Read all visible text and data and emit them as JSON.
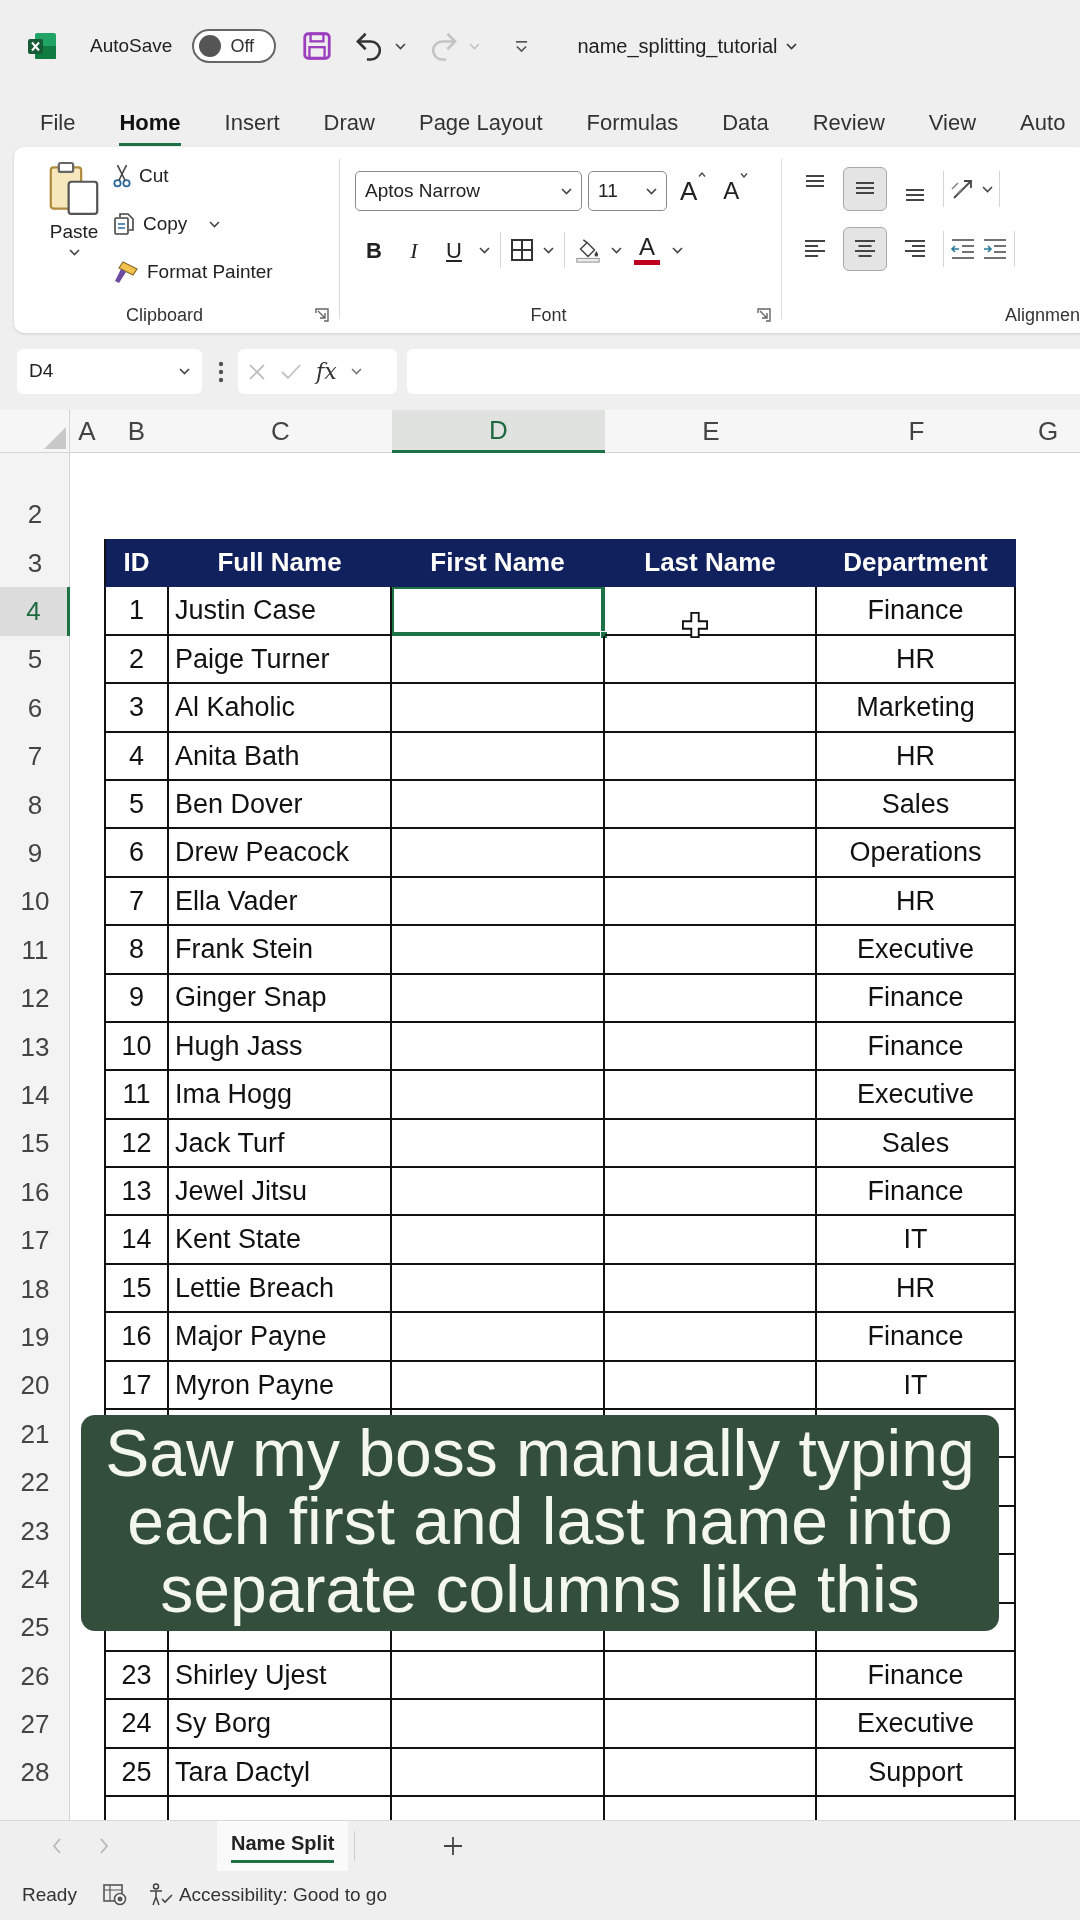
{
  "title_bar": {
    "autosave_label": "AutoSave",
    "autosave_toggle": {
      "label": "Off",
      "on": false
    },
    "undo": {
      "disabled": false
    },
    "redo": {
      "disabled": true
    },
    "file_name": "name_splitting_tutorial"
  },
  "ribbon_tabs": [
    {
      "label": "File",
      "selected": false
    },
    {
      "label": "Home",
      "selected": true
    },
    {
      "label": "Insert",
      "selected": false
    },
    {
      "label": "Draw",
      "selected": false
    },
    {
      "label": "Page Layout",
      "selected": false
    },
    {
      "label": "Formulas",
      "selected": false
    },
    {
      "label": "Data",
      "selected": false
    },
    {
      "label": "Review",
      "selected": false
    },
    {
      "label": "View",
      "selected": false
    },
    {
      "label": "Auto",
      "selected": false
    }
  ],
  "ribbon": {
    "clipboard": {
      "paste": "Paste",
      "cut": "Cut",
      "copy": "Copy",
      "format_painter": "Format Painter",
      "label": "Clipboard"
    },
    "font": {
      "font_name": "Aptos Narrow",
      "font_size": "11",
      "grow": "A",
      "shrink": "A",
      "bold": "B",
      "italic": "I",
      "underline": "U",
      "font_color": "A",
      "label": "Font"
    },
    "alignment": {
      "vertical": [
        {
          "kind": "top",
          "selected": false
        },
        {
          "kind": "middle",
          "selected": true
        },
        {
          "kind": "bottom",
          "selected": false
        }
      ],
      "horizontal": [
        {
          "kind": "left",
          "selected": false
        },
        {
          "kind": "center",
          "selected": true
        },
        {
          "kind": "right",
          "selected": false
        }
      ],
      "label": "Alignmen"
    }
  },
  "formula_bar": {
    "name_box": "D4",
    "function_label": "fx"
  },
  "sheet": {
    "columns": [
      {
        "letter": "A",
        "selected": false
      },
      {
        "letter": "B",
        "selected": false
      },
      {
        "letter": "C",
        "selected": false
      },
      {
        "letter": "D",
        "selected": true
      },
      {
        "letter": "E",
        "selected": false
      },
      {
        "letter": "F",
        "selected": false
      },
      {
        "letter": "G",
        "selected": false
      }
    ],
    "table_header": [
      "ID",
      "Full Name",
      "First Name",
      "Last Name",
      "Department"
    ],
    "rows": [
      {
        "number": "2",
        "kind": "blank",
        "selected": false
      },
      {
        "number": "3",
        "kind": "header",
        "selected": false
      },
      {
        "number": "4",
        "kind": "record",
        "selected": true,
        "id": "1",
        "full_name": "Justin Case",
        "department": "Finance"
      },
      {
        "number": "5",
        "kind": "record",
        "selected": false,
        "id": "2",
        "full_name": "Paige Turner",
        "department": "HR"
      },
      {
        "number": "6",
        "kind": "record",
        "selected": false,
        "id": "3",
        "full_name": "Al Kaholic",
        "department": "Marketing"
      },
      {
        "number": "7",
        "kind": "record",
        "selected": false,
        "id": "4",
        "full_name": "Anita Bath",
        "department": "HR"
      },
      {
        "number": "8",
        "kind": "record",
        "selected": false,
        "id": "5",
        "full_name": "Ben Dover",
        "department": "Sales"
      },
      {
        "number": "9",
        "kind": "record",
        "selected": false,
        "id": "6",
        "full_name": "Drew Peacock",
        "department": "Operations"
      },
      {
        "number": "10",
        "kind": "record",
        "selected": false,
        "id": "7",
        "full_name": "Ella Vader",
        "department": "HR"
      },
      {
        "number": "11",
        "kind": "record",
        "selected": false,
        "id": "8",
        "full_name": "Frank Stein",
        "department": "Executive"
      },
      {
        "number": "12",
        "kind": "record",
        "selected": false,
        "id": "9",
        "full_name": "Ginger Snap",
        "department": "Finance"
      },
      {
        "number": "13",
        "kind": "record",
        "selected": false,
        "id": "10",
        "full_name": "Hugh Jass",
        "department": "Finance"
      },
      {
        "number": "14",
        "kind": "record",
        "selected": false,
        "id": "11",
        "full_name": "Ima Hogg",
        "department": "Executive"
      },
      {
        "number": "15",
        "kind": "record",
        "selected": false,
        "id": "12",
        "full_name": "Jack Turf",
        "department": "Sales"
      },
      {
        "number": "16",
        "kind": "record",
        "selected": false,
        "id": "13",
        "full_name": "Jewel Jitsu",
        "department": "Finance"
      },
      {
        "number": "17",
        "kind": "record",
        "selected": false,
        "id": "14",
        "full_name": "Kent State",
        "department": "IT"
      },
      {
        "number": "18",
        "kind": "record",
        "selected": false,
        "id": "15",
        "full_name": "Lettie Breach",
        "department": "HR"
      },
      {
        "number": "19",
        "kind": "record",
        "selected": false,
        "id": "16",
        "full_name": "Major Payne",
        "department": "Finance"
      },
      {
        "number": "20",
        "kind": "record",
        "selected": false,
        "id": "17",
        "full_name": "Myron Payne",
        "department": "IT"
      },
      {
        "number": "21",
        "kind": "record",
        "selected": false
      },
      {
        "number": "22",
        "kind": "record",
        "selected": false
      },
      {
        "number": "23",
        "kind": "record",
        "selected": false
      },
      {
        "number": "24",
        "kind": "record",
        "selected": false
      },
      {
        "number": "25",
        "kind": "record",
        "selected": false
      },
      {
        "number": "26",
        "kind": "record",
        "selected": false,
        "id": "23",
        "full_name": "Shirley Ujest",
        "department": "Finance"
      },
      {
        "number": "27",
        "kind": "record",
        "selected": false,
        "id": "24",
        "full_name": "Sy Borg",
        "department": "Executive"
      },
      {
        "number": "28",
        "kind": "record",
        "selected": false,
        "id": "25",
        "full_name": "Tara Dactyl",
        "department": "Support"
      },
      {
        "kind": "record",
        "selected": false
      }
    ]
  },
  "caption": {
    "lines": [
      "Saw my boss manually typing",
      "each first and last name into",
      "separate columns like this"
    ]
  },
  "sheet_tabs": [
    {
      "label": "Name Split",
      "selected": true
    }
  ],
  "status_bar": {
    "mode": "Ready",
    "accessibility": "Accessibility: Good to go"
  }
}
